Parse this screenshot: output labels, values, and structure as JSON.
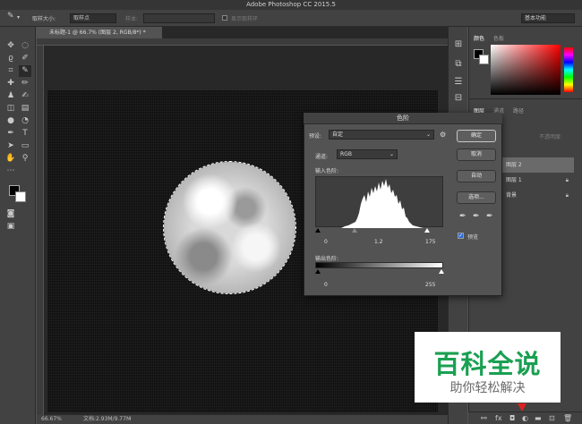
{
  "window": {
    "title": "Adobe Photoshop CC 2015.5"
  },
  "options_bar": {
    "sample_size_label": "取样大小:",
    "sample_size_value": "取样点",
    "sample_label": "样本:",
    "show_ring_label": "显示取样环",
    "workspace": "基本功能"
  },
  "document": {
    "tab_title": "未标题-1 @ 66.7% (图层 2, RGB/8*) *",
    "zoom": "66.67%",
    "doc_size": "文档:2.93M/9.77M"
  },
  "panels": {
    "color_tabs": [
      "颜色",
      "色板"
    ],
    "layer_tabs": [
      "图层",
      "通道",
      "路径"
    ],
    "lock_opacity_label": "不透明度:",
    "layers": [
      {
        "name": "图层 2",
        "selected": true
      },
      {
        "name": "图层 1",
        "selected": false
      },
      {
        "name": "背景",
        "selected": false
      }
    ],
    "colors": {
      "accent": "#2b6cd8",
      "bg": "#535353",
      "dark": "#424242"
    }
  },
  "levels_dialog": {
    "title": "色阶",
    "preset_label": "预设:",
    "preset_value": "自定",
    "channel_label": "通道:",
    "channel_value": "RGB",
    "input_label": "输入色阶:",
    "input_values": {
      "black": "0",
      "gamma": "1.2",
      "white": "175"
    },
    "output_label": "输出色阶:",
    "output_values": {
      "black": "0",
      "white": "255"
    },
    "buttons": {
      "ok": "确定",
      "cancel": "取消",
      "auto": "自动",
      "options": "选项..."
    },
    "preview_label": "预览",
    "preview_checked": true
  },
  "watermark": {
    "title": "百科全说",
    "subtitle": "助你轻松解决"
  }
}
